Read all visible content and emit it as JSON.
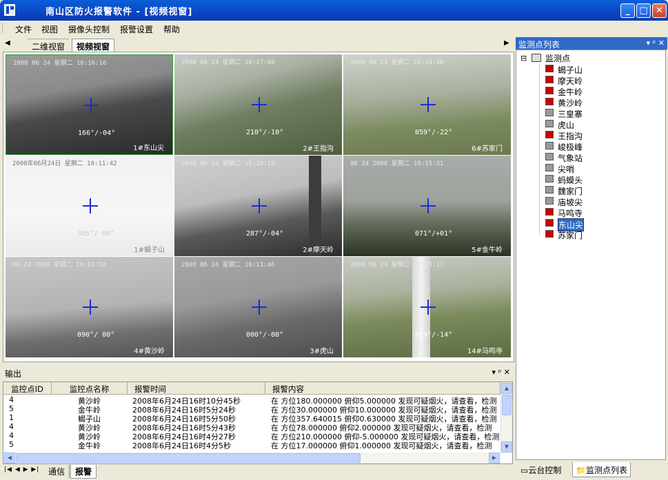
{
  "window": {
    "title": "南山区防火报警软件 - [视频视窗]",
    "min": "_",
    "max": "□",
    "close": "✕"
  },
  "menu": [
    "文件",
    "视图",
    "摄像头控制",
    "报警设置",
    "帮助"
  ],
  "doc_tabs": {
    "left_arrow": "◀",
    "tab1": "二维视窗",
    "tab2": "视频视窗",
    "right_arrow": "▶"
  },
  "cameras": [
    {
      "ts": "2008 06 24 星期二 16:16:16",
      "ptz": "166°/-04°",
      "name": "1#东山尖"
    },
    {
      "ts": "2008 06 24 星期二 16:17:08",
      "ptz": "210°/-10°",
      "name": "2#王指沟"
    },
    {
      "ts": "2008 06 24 星期二 16:14:40",
      "ptz": "059°/-22°",
      "name": "6#苏家门"
    },
    {
      "ts": "2008年06月24日 星期二 16:11:42",
      "ptz": "305°/ 00°",
      "name": "1#蝎子山"
    },
    {
      "ts": "2008 06 24 星期二 16:10:18",
      "ptz": "287°/-04°",
      "name": "2#摩天岭"
    },
    {
      "ts": "06 24 2008 星期二 16:15:31",
      "ptz": "071°/+01°",
      "name": "5#金牛岭"
    },
    {
      "ts": "06-24-2008 星期二 16:16:59",
      "ptz": "090°/ 00°",
      "name": "4#黄沙岭"
    },
    {
      "ts": "2008 06 24 星期二 16:11:46",
      "ptz": "000°/-00°",
      "name": "3#虎山"
    },
    {
      "ts": "2008 06 24 星期二 16:15:17",
      "ptz": "039°/-14°",
      "name": "14#马鸣寺"
    }
  ],
  "output": {
    "title": "输出",
    "pin": "▾ ᵖ ✕"
  },
  "grid": {
    "headers": [
      "监控点ID",
      "监控点名称",
      "报警时间",
      "报警内容"
    ],
    "rows": [
      [
        "4",
        "黄沙岭",
        "2008年6月24日16时10分45秒",
        "在 方位180.000000 俯仰5.000000 发现可疑烟火，请查看，检测"
      ],
      [
        "5",
        "金牛岭",
        "2008年6月24日16时5分24秒",
        "在 方位30.000000 俯仰10.000000 发现可疑烟火，请查看，检测"
      ],
      [
        "1",
        "蝎子山",
        "2008年6月24日16时5分50秒",
        "在 方位357.640015 俯仰0.630000 发现可疑烟火，请查看，检测"
      ],
      [
        "4",
        "黄沙岭",
        "2008年6月24日16时5分43秒",
        "在 方位78.000000 俯仰2.000000 发现可疑烟火，请查看，检测"
      ],
      [
        "4",
        "黄沙岭",
        "2008年6月24日16时4分27秒",
        "在 方位210.000000 俯仰-5.000000 发现可疑烟火，请查看，检测"
      ],
      [
        "5",
        "金牛岭",
        "2008年6月24日16时4分5秒",
        "在 方位17.000000 俯仰1.000000 发现可疑烟火，请查看，检测"
      ]
    ]
  },
  "bottom_tabs": {
    "nav": "|◀ ◀ ▶ ▶|",
    "tab1": "通信",
    "tab2": "报警"
  },
  "panel": {
    "title": "监测点列表",
    "controls": "▾ ᵖ ✕",
    "root": "监测点",
    "expander": "⊟"
  },
  "tree": [
    "蝎子山",
    "摩天岭",
    "金牛岭",
    "黄沙岭",
    "三皇寨",
    "虎山",
    "王指沟",
    "峻极峰",
    "气象站",
    "尖哨",
    "蚂蟆头",
    "魏家门",
    "庙坡尖",
    "马鸣寺",
    "东山尖",
    "苏家门"
  ],
  "tree_icon_state": [
    "red",
    "red",
    "red",
    "red",
    "gray",
    "gray",
    "red",
    "gray",
    "gray",
    "gray",
    "gray",
    "gray",
    "gray",
    "red",
    "red",
    "red"
  ],
  "right_tabs": {
    "tab1": "云台控制",
    "tab2": "监测点列表"
  }
}
